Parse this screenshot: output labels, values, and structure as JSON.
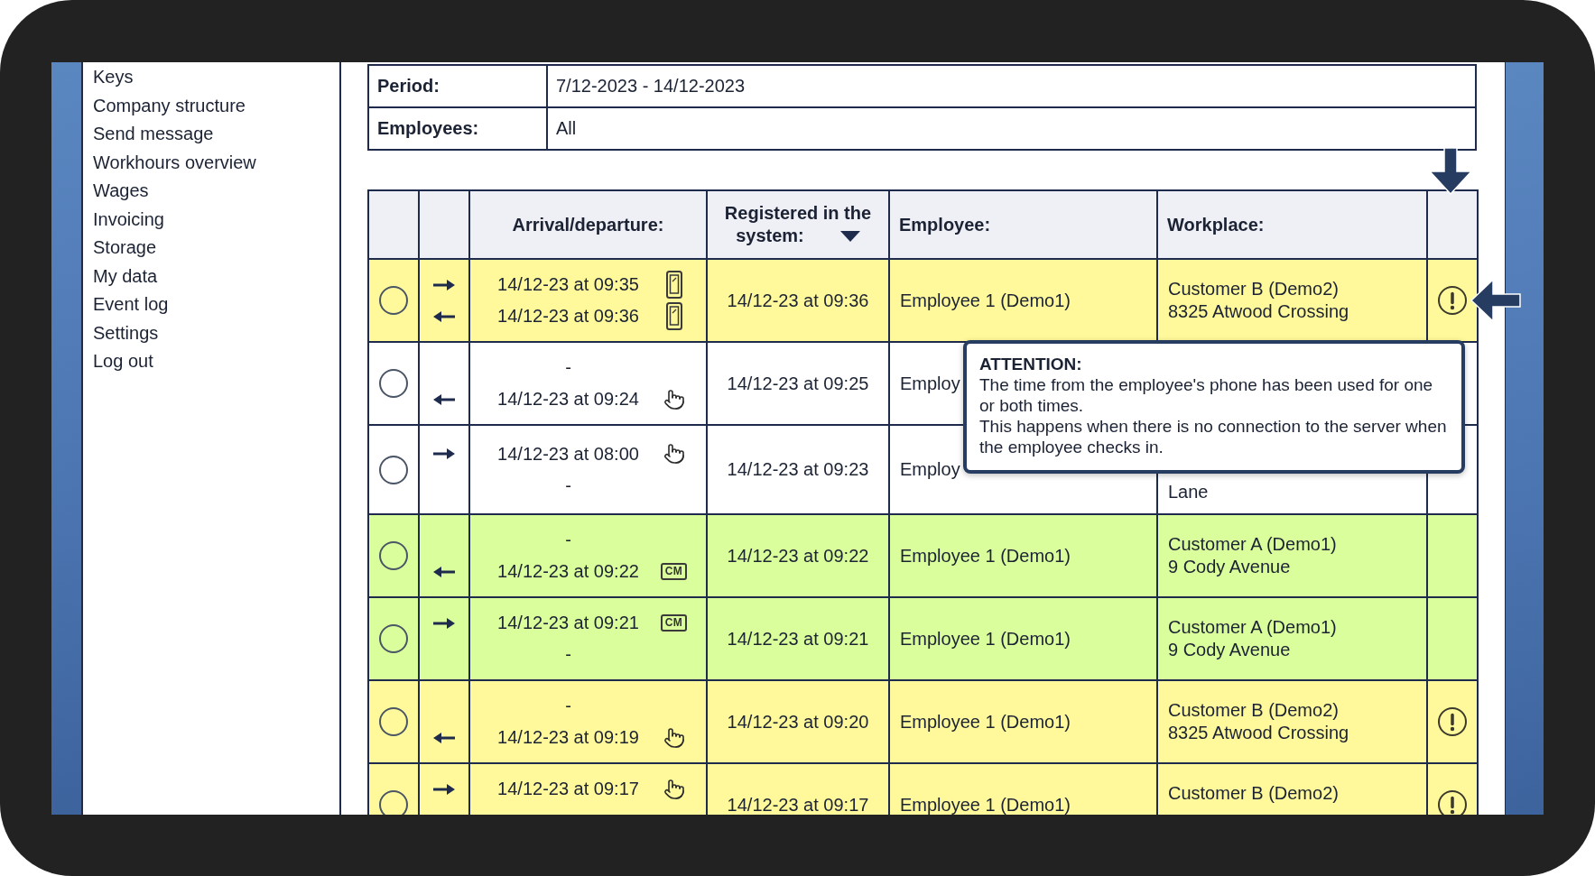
{
  "sidebar": {
    "items": [
      {
        "label": "Keys"
      },
      {
        "label": "Company structure"
      },
      {
        "label": "Send message"
      },
      {
        "label": "Workhours overview"
      },
      {
        "label": "Wages"
      },
      {
        "label": "Invoicing"
      },
      {
        "label": "Storage"
      },
      {
        "label": "My data"
      },
      {
        "label": "Event log"
      },
      {
        "label": "Settings"
      },
      {
        "label": "Log out"
      }
    ]
  },
  "filters": [
    {
      "label": "Period:",
      "value": "7/12-2023 - 14/12-2023"
    },
    {
      "label": "Employees:",
      "value": "All"
    }
  ],
  "table": {
    "columns": [
      {
        "kind": "select"
      },
      {
        "kind": "direction"
      },
      {
        "kind": "time",
        "label": "Arrival/departure:"
      },
      {
        "kind": "time",
        "label": "Registered in the system:",
        "sorted": true
      },
      {
        "kind": "text",
        "label": "Employee:"
      },
      {
        "kind": "text",
        "label": "Workplace:"
      },
      {
        "kind": "warning"
      }
    ],
    "rows": [
      {
        "color": "#fff99b",
        "selected": false,
        "arrival": {
          "kind": "phone",
          "text": "14/12-23 at 09:35"
        },
        "departure": {
          "kind": "phone",
          "text": "14/12-23 at 09:36"
        },
        "registered": "14/12-23 at 09:36",
        "employee": "Employee 1 (Demo1)",
        "workplace": {
          "line_1": "Customer B (Demo2)",
          "line_2": "8325 Atwood Crossing"
        },
        "warning": true
      },
      {
        "color": "#ffffff",
        "selected": false,
        "arrival": {
          "kind": "blank",
          "text": "-"
        },
        "departure": {
          "kind": "hand",
          "text": "14/12-23 at 09:24"
        },
        "registered": "14/12-23 at 09:25",
        "employee": "Employ",
        "warning": false
      },
      {
        "color": "#ffffff",
        "selected": false,
        "arrival": {
          "kind": "hand",
          "text": "14/12-23 at 08:00"
        },
        "departure": {
          "kind": "blank",
          "text": "-"
        },
        "registered": "14/12-23 at 09:23",
        "employee": "Employ",
        "workplace": {
          "line_3": "Lane"
        },
        "warning": false
      },
      {
        "color": "#dbfe9c",
        "selected": false,
        "arrival": {
          "kind": "blank",
          "text": "-"
        },
        "departure": {
          "kind": "cm",
          "text": "14/12-23 at 09:22",
          "badge": "CM"
        },
        "registered": "14/12-23 at 09:22",
        "employee": "Employee 1 (Demo1)",
        "workplace": {
          "line_1": "Customer A (Demo1)",
          "line_2": "9 Cody Avenue"
        },
        "warning": false
      },
      {
        "color": "#dbfe9c",
        "selected": false,
        "arrival": {
          "kind": "cm",
          "text": "14/12-23 at 09:21",
          "badge": "CM"
        },
        "departure": {
          "kind": "blank",
          "text": "-"
        },
        "registered": "14/12-23 at 09:21",
        "employee": "Employee 1 (Demo1)",
        "workplace": {
          "line_1": "Customer A (Demo1)",
          "line_2": "9 Cody Avenue"
        },
        "warning": false
      },
      {
        "color": "#fff99b",
        "selected": false,
        "arrival": {
          "kind": "blank",
          "text": "-"
        },
        "departure": {
          "kind": "hand",
          "text": "14/12-23 at 09:19"
        },
        "registered": "14/12-23 at 09:20",
        "employee": "Employee 1 (Demo1)",
        "workplace": {
          "line_1": "Customer B (Demo2)",
          "line_2": "8325 Atwood Crossing"
        },
        "warning": true
      },
      {
        "color": "#fff99b",
        "selected": false,
        "arrival": {
          "kind": "hand",
          "text": "14/12-23 at 09:17"
        },
        "registered": "14/12-23 at 09:17",
        "employee": "Employee 1 (Demo1)",
        "workplace": {
          "line_1": "Customer B (Demo2)"
        },
        "warning": true
      }
    ]
  },
  "tooltip": {
    "title": "ATTENTION:",
    "paragraphs": [
      "The time from the employee's phone has been used for one or both times.",
      "This happens when there is no connection to the server when the employee checks in."
    ]
  }
}
